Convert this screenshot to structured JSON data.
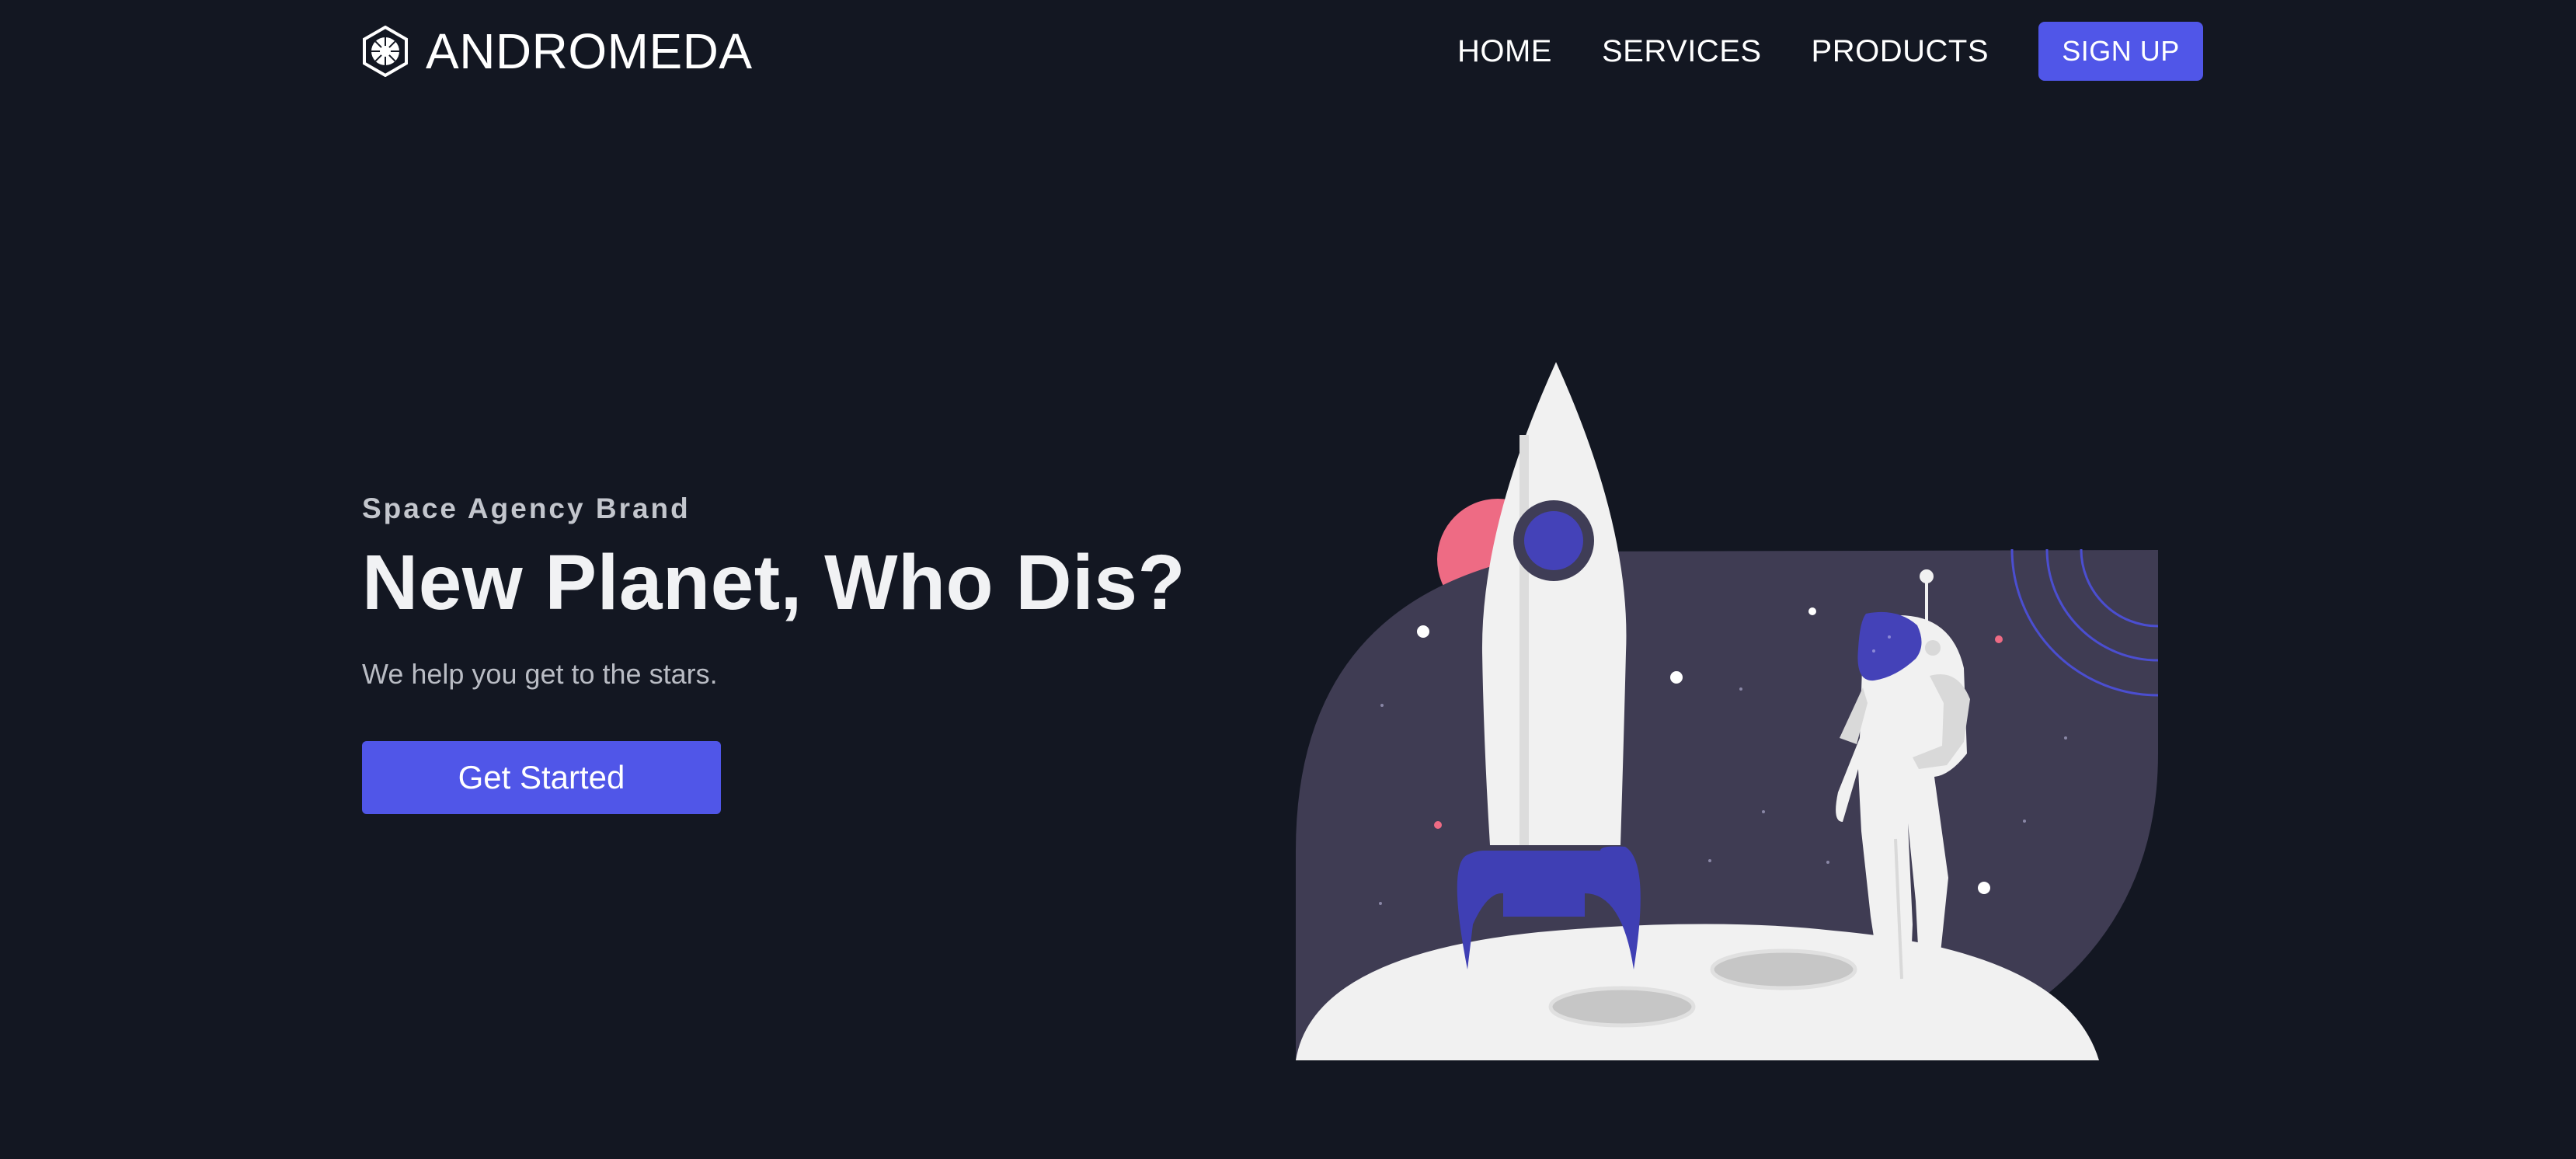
{
  "nav": {
    "brand": "ANDROMEDA",
    "logo_icon": "hexagon-starburst-icon",
    "links": [
      "HOME",
      "SERVICES",
      "PRODUCTS"
    ],
    "signup_label": "SIGN UP"
  },
  "hero": {
    "eyebrow": "Space Agency Brand",
    "headline": "New Planet, Who Dis?",
    "subtext": "We help you get to the stars.",
    "cta_label": "Get Started"
  },
  "illustration": {
    "subject": "rocket-and-astronaut-on-moon"
  },
  "colors": {
    "background": "#131722",
    "accent": "#5056e8",
    "panel": "#3f3c53",
    "moon": "#f1f1f1",
    "rocket_blue": "#3f3fb4",
    "pink": "#ee6b84"
  }
}
